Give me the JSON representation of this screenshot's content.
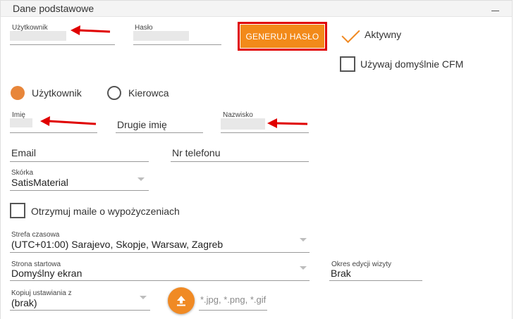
{
  "panel": {
    "title": "Dane podstawowe",
    "collapse_glyph": "—"
  },
  "login": {
    "username_label": "Użytkownik",
    "password_label": "Hasło",
    "generate_button": "GENERUJ HASŁO",
    "active_label": "Aktywny",
    "default_cfm_label": "Używaj domyślnie CFM"
  },
  "user_type": {
    "option_user": "Użytkownik",
    "option_driver": "Kierowca",
    "selected": "Użytkownik"
  },
  "names": {
    "first_label": "Imię",
    "middle_placeholder": "Drugie imię",
    "last_label": "Nazwisko"
  },
  "contact": {
    "email_placeholder": "Email",
    "phone_placeholder": "Nr telefonu"
  },
  "skin": {
    "label": "Skórka",
    "value": "SatisMaterial"
  },
  "mail_checkbox_label": "Otrzymuj maile o wypożyczeniach",
  "timezone": {
    "label": "Strefa czasowa",
    "value": "(UTC+01:00) Sarajevo, Skopje, Warsaw, Zagreb"
  },
  "start_page": {
    "label": "Strona startowa",
    "value": "Domyślny ekran"
  },
  "visit_edit": {
    "label": "Okres edycji wizyty",
    "value": "Brak"
  },
  "copy_settings": {
    "label": "Kopiuj ustawiania z",
    "value": "(brak)"
  },
  "upload": {
    "placeholder": "*.jpg, *.png, *.gif",
    "icon": "upload-icon"
  },
  "colors": {
    "accent": "#f28a1a",
    "highlight_red": "#e00000",
    "annotation_arrow": "#e00000"
  }
}
